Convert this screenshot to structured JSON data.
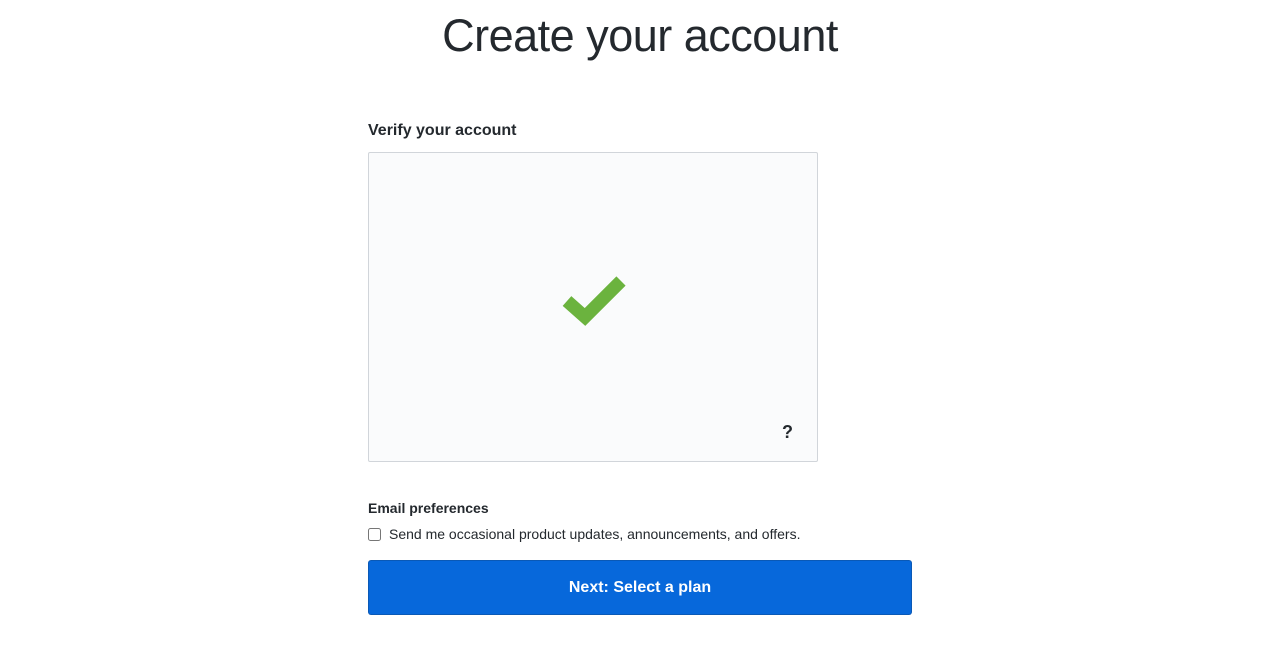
{
  "page": {
    "title": "Create your account"
  },
  "verify": {
    "label": "Verify your account",
    "help_symbol": "?"
  },
  "email_prefs": {
    "heading": "Email preferences",
    "checkbox_label": "Send me occasional product updates, announcements, and offers.",
    "checked": false
  },
  "buttons": {
    "next": "Next: Select a plan"
  },
  "colors": {
    "primary": "#0768db",
    "success": "#6bb33e",
    "border": "#d1d5da",
    "panel_bg": "#fafbfc"
  }
}
